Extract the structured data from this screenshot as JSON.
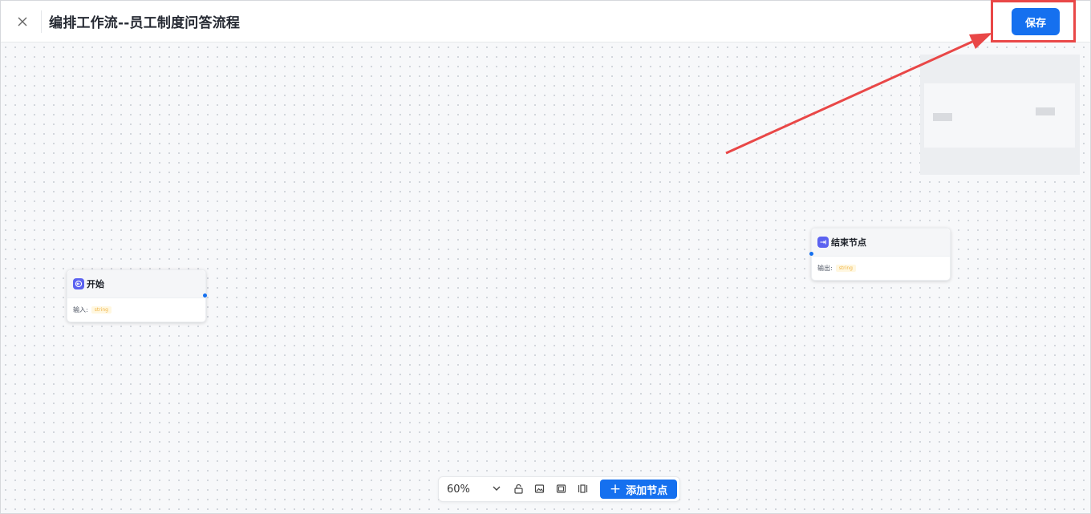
{
  "header": {
    "close_icon": "close-icon",
    "title": "编排工作流--员工制度问答流程",
    "save_label": "保存"
  },
  "canvas": {
    "nodes": [
      {
        "title": "开始",
        "io_label": "输入:",
        "type_tag": "string",
        "icon": "start-icon"
      },
      {
        "title": "结束节点",
        "io_label": "输出:",
        "type_tag": "string",
        "icon": "end-icon"
      }
    ]
  },
  "toolbar": {
    "zoom": "60%",
    "add_node_label": "添加节点",
    "icons": [
      "lock-icon",
      "image-icon",
      "fit-view-icon",
      "layout-icon",
      "plus-icon"
    ]
  },
  "colors": {
    "primary": "#1570ef",
    "node_icon": "#5b62f0",
    "annotation": "#e94747",
    "tag_bg": "#fff7e0",
    "tag_text": "#f0b548"
  }
}
